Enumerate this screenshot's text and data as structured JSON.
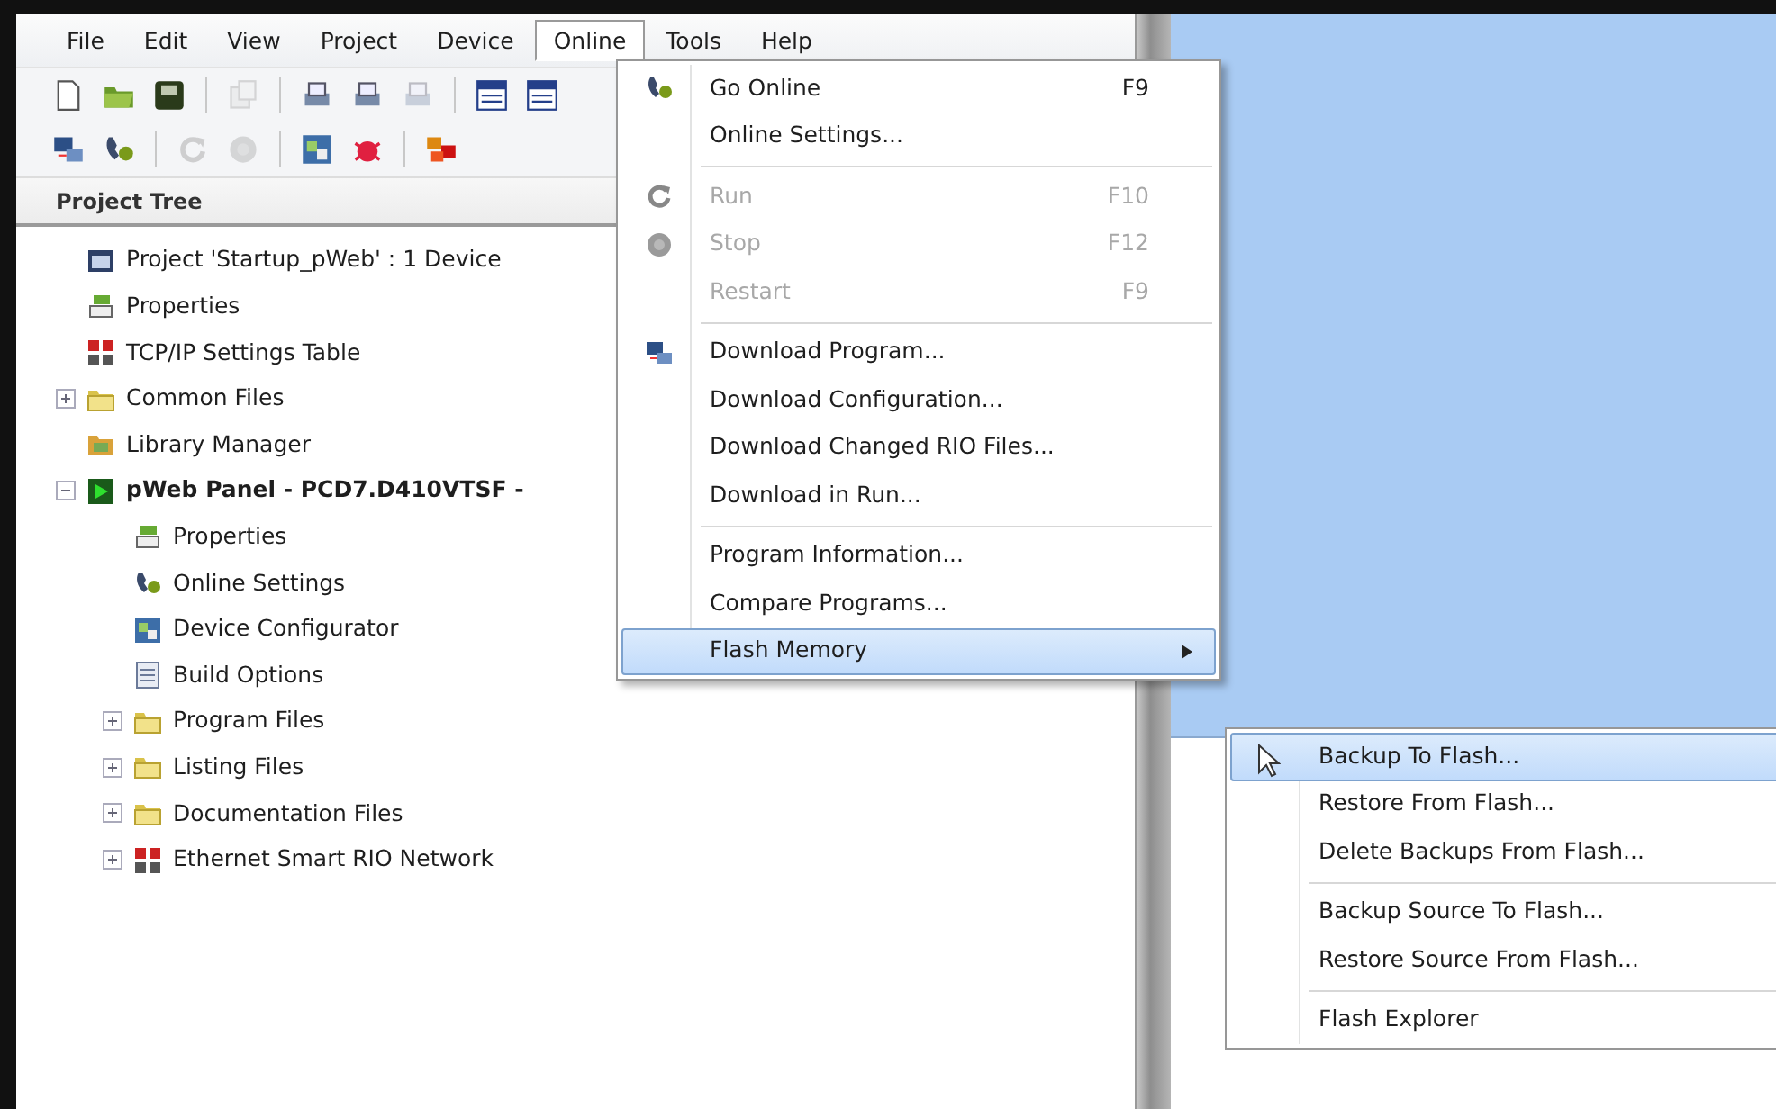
{
  "menu_bar": [
    {
      "label": "File",
      "selected": false
    },
    {
      "label": "Edit",
      "selected": false
    },
    {
      "label": "View",
      "selected": false
    },
    {
      "label": "Project",
      "selected": false
    },
    {
      "label": "Device",
      "selected": false
    },
    {
      "label": "Online",
      "selected": true
    },
    {
      "label": "Tools",
      "selected": false
    },
    {
      "label": "Help",
      "selected": false
    }
  ],
  "toolbars": [
    [
      {
        "kind": "new",
        "disabled": false
      },
      {
        "kind": "open",
        "disabled": false
      },
      {
        "kind": "save",
        "disabled": false
      },
      {
        "kind": "sep"
      },
      {
        "kind": "copy",
        "disabled": true
      },
      {
        "kind": "sep"
      },
      {
        "kind": "print",
        "disabled": false
      },
      {
        "kind": "print",
        "disabled": false
      },
      {
        "kind": "print",
        "disabled": true
      },
      {
        "kind": "sep"
      },
      {
        "kind": "window",
        "disabled": false
      },
      {
        "kind": "window",
        "disabled": false
      }
    ],
    [
      {
        "kind": "download",
        "disabled": false
      },
      {
        "kind": "online",
        "disabled": false
      },
      {
        "kind": "sep"
      },
      {
        "kind": "run",
        "disabled": true
      },
      {
        "kind": "stop",
        "disabled": true
      },
      {
        "kind": "sep"
      },
      {
        "kind": "config",
        "disabled": false
      },
      {
        "kind": "bug",
        "disabled": false
      },
      {
        "kind": "sep"
      },
      {
        "kind": "network",
        "disabled": false
      }
    ]
  ],
  "project_tree": {
    "title": "Project Tree",
    "items": [
      {
        "label": "Project 'Startup_pWeb' : 1 Device",
        "kind": "project",
        "active": false
      },
      {
        "label": "Properties",
        "kind": "properties",
        "active": false
      },
      {
        "label": "TCP/IP Settings Table",
        "kind": "table",
        "active": false
      },
      {
        "label": "Common Files",
        "kind": "folder",
        "active": false,
        "expanded": false
      },
      {
        "label": "Library Manager",
        "kind": "library",
        "active": false
      },
      {
        "label": "pWeb Panel - PCD7.D410VTSF -",
        "kind": "device",
        "active": true,
        "expanded": true,
        "children": [
          {
            "label": "Properties",
            "kind": "properties"
          },
          {
            "label": "Online Settings",
            "kind": "online"
          },
          {
            "label": "Device Configurator",
            "kind": "config"
          },
          {
            "label": "Build Options",
            "kind": "build"
          },
          {
            "label": "Program Files",
            "kind": "folder",
            "expanded": false
          },
          {
            "label": "Listing Files",
            "kind": "folder",
            "expanded": false
          },
          {
            "label": "Documentation Files",
            "kind": "folder",
            "expanded": false
          },
          {
            "label": "Ethernet Smart RIO Network",
            "kind": "table",
            "expanded": false
          }
        ]
      }
    ]
  },
  "online_menu": {
    "items": [
      {
        "kind": "online",
        "label": "Go Online",
        "shortcut": "F9",
        "disabled": false,
        "selected": false
      },
      {
        "kind": "item",
        "label": "Online Settings...",
        "disabled": false,
        "selected": false
      },
      {
        "kind": "separator"
      },
      {
        "kind": "run",
        "label": "Run",
        "shortcut": "F10",
        "disabled": true,
        "selected": false
      },
      {
        "kind": "stop",
        "label": "Stop",
        "shortcut": "F12",
        "disabled": true,
        "selected": false
      },
      {
        "kind": "item",
        "label": "Restart",
        "shortcut": "F9",
        "disabled": true,
        "selected": false
      },
      {
        "kind": "separator"
      },
      {
        "kind": "download",
        "label": "Download Program...",
        "disabled": false,
        "selected": false
      },
      {
        "kind": "item",
        "label": "Download Configuration...",
        "disabled": false,
        "selected": false
      },
      {
        "kind": "item",
        "label": "Download Changed RIO Files...",
        "disabled": false,
        "selected": false
      },
      {
        "kind": "item",
        "label": "Download in Run...",
        "disabled": false,
        "selected": false
      },
      {
        "kind": "separator"
      },
      {
        "kind": "item",
        "label": "Program Information...",
        "disabled": false,
        "selected": false
      },
      {
        "kind": "item",
        "label": "Compare Programs...",
        "disabled": false,
        "selected": false
      },
      {
        "kind": "submenu",
        "label": "Flash Memory",
        "disabled": false,
        "selected": true
      }
    ]
  },
  "flash_submenu": {
    "items": [
      {
        "kind": "item",
        "label": "Backup To Flash...",
        "selected": true
      },
      {
        "kind": "item",
        "label": "Restore From Flash...",
        "selected": false
      },
      {
        "kind": "item",
        "label": "Delete Backups From Flash...",
        "selected": false
      },
      {
        "kind": "separator"
      },
      {
        "kind": "item",
        "label": "Backup Source To Flash...",
        "selected": false
      },
      {
        "kind": "item",
        "label": "Restore Source From Flash...",
        "selected": false
      },
      {
        "kind": "separator"
      },
      {
        "kind": "item",
        "label": "Flash Explorer",
        "selected": false
      }
    ]
  }
}
